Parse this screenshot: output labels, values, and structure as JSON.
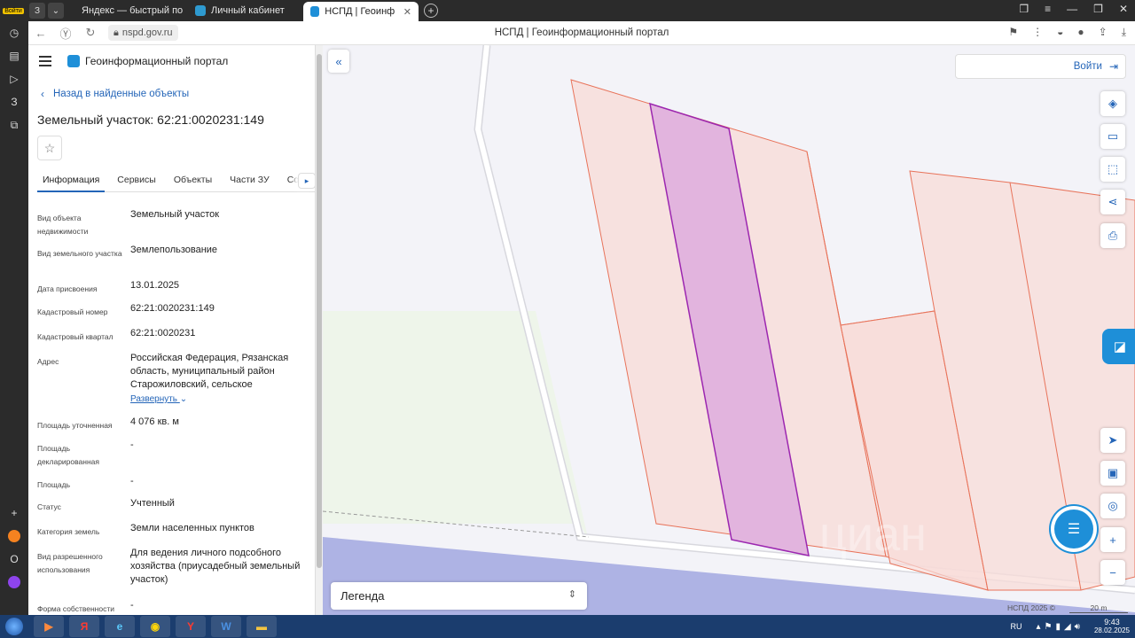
{
  "browser": {
    "profile_label": "Войти",
    "tabs": [
      {
        "label": "Яндекс — быстрый поиск",
        "favicon_color": "#e53935"
      },
      {
        "label": "Личный кабинет",
        "favicon_color": "#2e9ad0"
      },
      {
        "label": "НСПД | Геоинформационный",
        "favicon_color": "#1e8fd8",
        "active": true
      }
    ],
    "url": "nspd.gov.ru",
    "page_title": "НСПД | Геоинформационный портал"
  },
  "panel": {
    "brand": "Геоинформационный портал",
    "back_label": "Назад в найденные объекты",
    "title": "Земельный участок: 62:21:0020231:149",
    "tabs": [
      "Информация",
      "Сервисы",
      "Объекты",
      "Части ЗУ",
      "Соста"
    ],
    "expand_label": "Развернуть",
    "fields": [
      {
        "label": "Вид объекта недвижимости",
        "value": "Земельный участок"
      },
      {
        "label": "Вид земельного участка",
        "value": "Землепользование"
      },
      {
        "label": "Дата присвоения",
        "value": "13.01.2025"
      },
      {
        "label": "Кадастровый номер",
        "value": "62:21:0020231:149"
      },
      {
        "label": "Кадастровый квартал",
        "value": "62:21:0020231"
      },
      {
        "label": "Адрес",
        "value": "Российская Федерация, Рязанская область, муниципальный район Старожиловский, сельское"
      },
      {
        "label": "Площадь уточненная",
        "value": "4 076 кв. м"
      },
      {
        "label": "Площадь декларированная",
        "value": "-"
      },
      {
        "label": "Площадь",
        "value": "-"
      },
      {
        "label": "Статус",
        "value": "Учтенный"
      },
      {
        "label": "Категория земель",
        "value": "Земли населенных пунктов"
      },
      {
        "label": "Вид разрешенного использования",
        "value": "Для ведения личного подсобного хозяйства (приусадебный земельный участок)"
      },
      {
        "label": "Форма собственности",
        "value": "-"
      }
    ]
  },
  "map": {
    "login_label": "Войти",
    "legend_label": "Легенда",
    "copyright": "НСПД 2025 ©",
    "scale_label": "20 m",
    "watermark": "циан",
    "colors": {
      "parcel_stroke": "#e8735a",
      "parcel_fill": "#f8dcd8",
      "selected_stroke": "#9c27b0",
      "selected_fill": "#e2b4de",
      "road_blue": "#aeb3e4"
    }
  },
  "taskbar": {
    "lang": "RU",
    "time": "9:43",
    "date": "28.02.2025"
  }
}
